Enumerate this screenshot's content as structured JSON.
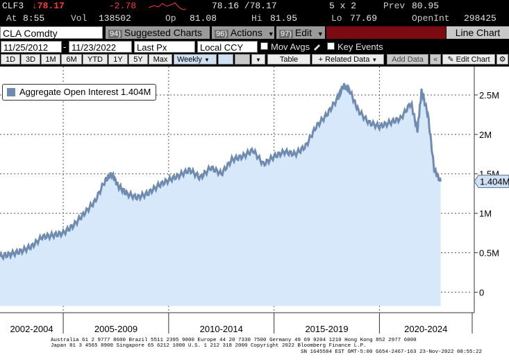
{
  "quote": {
    "ticker": "CLF3",
    "last": "↓78.17",
    "change": "-2.78",
    "bid_ask": "78.16 /78.17",
    "size": "5 x 2",
    "prev_label": "Prev",
    "prev": "80.95",
    "at_label": "At",
    "time": "8:55",
    "vol_label": "Vol",
    "vol": "138502",
    "open_label": "Op",
    "open": "81.08",
    "high_label": "Hi",
    "high": "81.95",
    "low_label": "Lo",
    "low": "77.69",
    "oi_label": "OpenInt",
    "oi": "298425"
  },
  "command_bar": {
    "security": "CLA Comdty",
    "suggested_num": "94)",
    "suggested_label": "Suggested Charts",
    "actions_num": "96)",
    "actions_label": "Actions",
    "edit_num": "97)",
    "edit_label": "Edit",
    "chart_type": "Line Chart"
  },
  "controls": {
    "start_date": "11/25/2012",
    "end_date": "11/23/2022",
    "field": "Last Px",
    "currency": "Local CCY",
    "mov_avgs": "Mov Avgs",
    "key_events": "Key Events",
    "periods": [
      "1D",
      "3D",
      "1M",
      "6M",
      "YTD",
      "1Y",
      "5Y",
      "Max"
    ],
    "frequency": "Weekly",
    "table": "Table",
    "related_data": "Related Data",
    "add_data": "Add Data",
    "edit_chart": "Edit Chart",
    "selected_period": "Weekly"
  },
  "legend": {
    "label": "Aggregate Open Interest 1.404M",
    "color": "#6f8bb0"
  },
  "colors": {
    "line": "#6f8bb0",
    "fill": "#d6e8fa",
    "last_value_bg": "#cfe0f5",
    "red_bar": "#7b0a13"
  },
  "chart_data": {
    "type": "area",
    "title": "",
    "xlabel": "",
    "ylabel": "",
    "series": [
      {
        "name": "Aggregate Open Interest",
        "unit": "M",
        "x": [
          2002.0,
          2002.5,
          2003.0,
          2003.5,
          2004.0,
          2004.5,
          2005.0,
          2005.5,
          2006.0,
          2006.5,
          2007.0,
          2007.3,
          2007.6,
          2008.0,
          2008.5,
          2009.0,
          2009.5,
          2010.0,
          2010.5,
          2011.0,
          2011.5,
          2012.0,
          2012.5,
          2013.0,
          2013.5,
          2014.0,
          2014.5,
          2015.0,
          2015.5,
          2016.0,
          2016.5,
          2017.0,
          2017.5,
          2018.0,
          2018.3,
          2018.6,
          2019.0,
          2019.5,
          2020.0,
          2020.5,
          2021.0,
          2021.5,
          2021.8,
          2022.0,
          2022.3,
          2022.6,
          2022.9
        ],
        "y": [
          0.45,
          0.48,
          0.52,
          0.58,
          0.7,
          0.72,
          0.75,
          0.85,
          1.0,
          1.15,
          1.42,
          1.5,
          1.35,
          1.25,
          1.2,
          1.25,
          1.35,
          1.42,
          1.48,
          1.55,
          1.45,
          1.58,
          1.5,
          1.68,
          1.72,
          1.8,
          1.62,
          1.72,
          1.78,
          1.75,
          1.85,
          2.1,
          2.25,
          2.45,
          2.62,
          2.55,
          2.3,
          2.15,
          2.1,
          2.15,
          2.2,
          2.4,
          2.05,
          2.55,
          2.25,
          1.55,
          1.404
        ]
      }
    ],
    "x_tick_labels": [
      "2002-2004",
      "2005-2009",
      "2010-2014",
      "2015-2019",
      "2020-2024"
    ],
    "y_tick_labels": [
      "0",
      "0.5M",
      "1M",
      "1.5M",
      "2M",
      "2.5M"
    ],
    "y_ticks": [
      0,
      0.5,
      1,
      1.5,
      2,
      2.5
    ],
    "xlim": [
      2002.0,
      2024.4
    ],
    "ylim": [
      -0.26,
      2.86
    ],
    "last_value": "1.404M",
    "grid": true,
    "legend_position": "top-left"
  },
  "footer": {
    "line1": "Australia 61 2 9777 8600 Brazil 5511 2395 9000 Europe 44 20 7330 7500 Germany 49 69 9204 1210 Hong Kong 852 2977 6000",
    "line2": "Japan 81 3 4565 8900        Singapore 65 6212 1000         U.S. 1 212 318 2000          Copyright 2022 Bloomberg Finance L.P.",
    "line3": "SN 1645584 EST  GMT-5:00 G654-2467-163 23-Nov-2022 08:55:22"
  }
}
